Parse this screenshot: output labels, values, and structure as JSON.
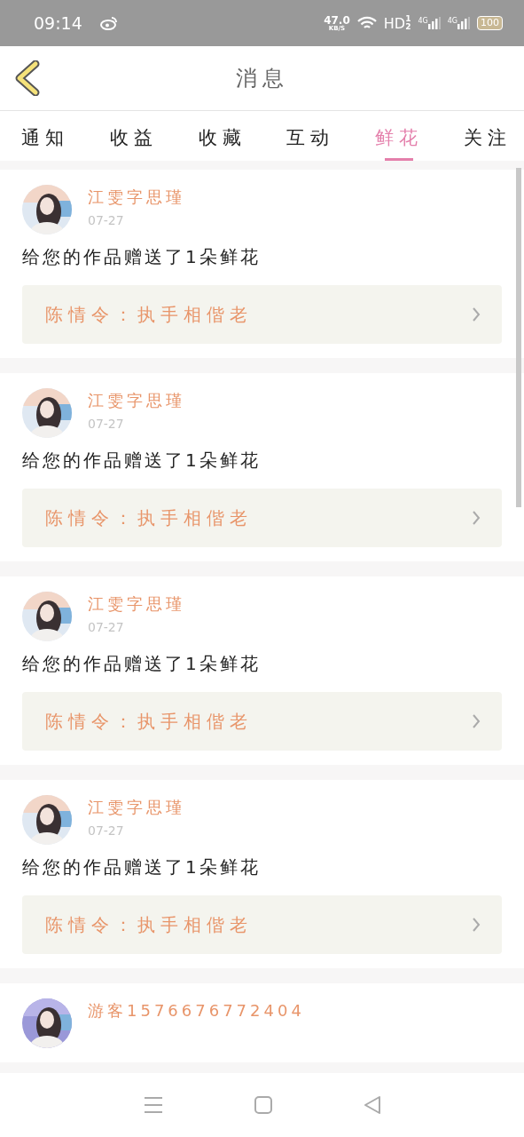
{
  "status_bar": {
    "time": "09:14",
    "speed": "47.0",
    "speed_unit": "KB/S",
    "hd": "HD",
    "hd_sub": [
      "1",
      "2"
    ],
    "net_1": "4G",
    "net_2": "4G",
    "battery": "100"
  },
  "header": {
    "title": "消息"
  },
  "tabs": [
    {
      "label": "通知",
      "selected": false
    },
    {
      "label": "收益",
      "selected": false
    },
    {
      "label": "收藏",
      "selected": false
    },
    {
      "label": "互动",
      "selected": false
    },
    {
      "label": "鲜花",
      "selected": true
    },
    {
      "label": "关注",
      "selected": false
    }
  ],
  "messages": [
    {
      "name": "江雯字思瑾",
      "date": "07-27",
      "text": "给您的作品赠送了1朵鲜花",
      "work": "陈情令：执手相偕老"
    },
    {
      "name": "江雯字思瑾",
      "date": "07-27",
      "text": "给您的作品赠送了1朵鲜花",
      "work": "陈情令：执手相偕老"
    },
    {
      "name": "江雯字思瑾",
      "date": "07-27",
      "text": "给您的作品赠送了1朵鲜花",
      "work": "陈情令：执手相偕老"
    },
    {
      "name": "江雯字思瑾",
      "date": "07-27",
      "text": "给您的作品赠送了1朵鲜花",
      "work": "陈情令：执手相偕老"
    },
    {
      "name": "游客1576676772404"
    }
  ]
}
